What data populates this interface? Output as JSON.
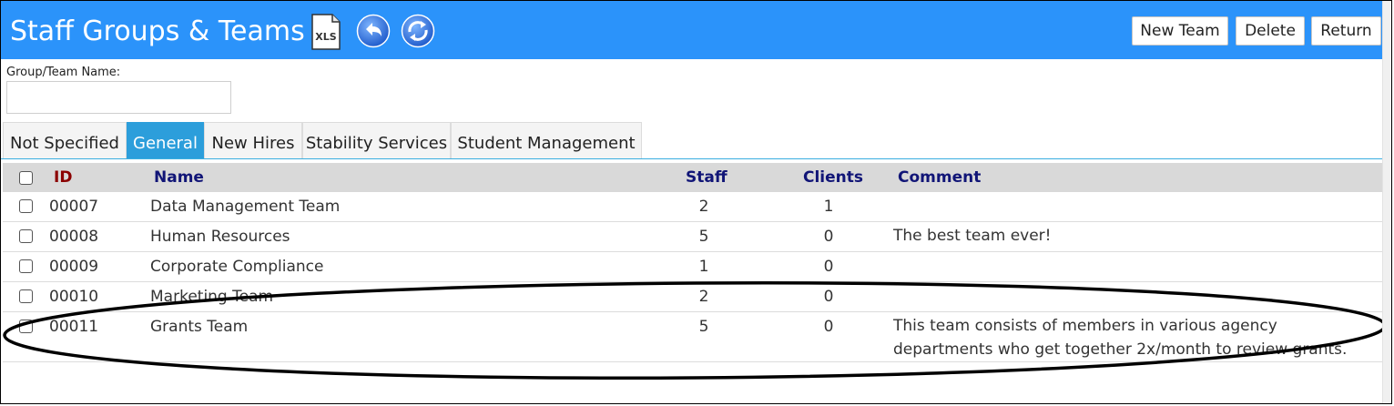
{
  "header": {
    "title": "Staff Groups & Teams",
    "xls_icon_label": "XLS",
    "icons": [
      "xls-icon",
      "back-icon",
      "refresh-icon"
    ],
    "buttons": {
      "new_team": "New Team",
      "delete": "Delete",
      "return": "Return"
    }
  },
  "form": {
    "group_team_name_label": "Group/Team Name:",
    "group_team_name_value": ""
  },
  "tabs": [
    {
      "label": "Not Specified",
      "active": false
    },
    {
      "label": "General",
      "active": true
    },
    {
      "label": "New Hires",
      "active": false
    },
    {
      "label": "Stability Services",
      "active": false
    },
    {
      "label": "Student Management",
      "active": false
    }
  ],
  "table": {
    "columns": {
      "id": "ID",
      "name": "Name",
      "staff": "Staff",
      "clients": "Clients",
      "comment": "Comment"
    },
    "rows": [
      {
        "id": "00007",
        "name": "Data Management Team",
        "staff": "2",
        "clients": "1",
        "comment": ""
      },
      {
        "id": "00008",
        "name": "Human Resources",
        "staff": "5",
        "clients": "0",
        "comment": "The best team ever!"
      },
      {
        "id": "00009",
        "name": "Corporate Compliance",
        "staff": "1",
        "clients": "0",
        "comment": ""
      },
      {
        "id": "00010",
        "name": "Marketing Team",
        "staff": "2",
        "clients": "0",
        "comment": ""
      },
      {
        "id": "00011",
        "name": "Grants Team",
        "staff": "5",
        "clients": "0",
        "comment": "This team consists of members in various agency departments who get together 2x/month to review grants."
      }
    ]
  },
  "colors": {
    "header_bg": "#2b93fa",
    "tab_active_bg": "#2c9edb",
    "column_header_text": "#111577",
    "id_header_text": "#8b0000",
    "table_header_bg": "#d9d9d9",
    "annotation_ellipse": "#000000"
  }
}
